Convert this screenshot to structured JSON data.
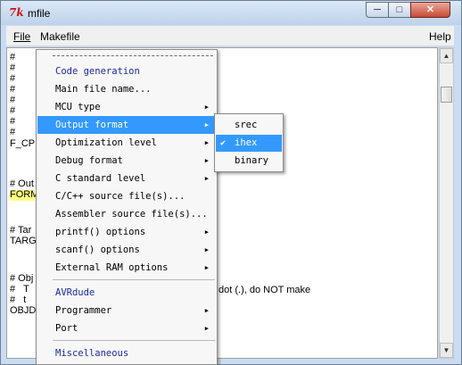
{
  "window": {
    "title": "mfile",
    "app_icon": "7k",
    "min": "─",
    "max": "□",
    "close": "✕"
  },
  "menubar": {
    "file": "File",
    "makefile": "Makefile",
    "help": "Help"
  },
  "editor": {
    "lines": [
      "#",
      "#",
      "#",
      "#",
      "#",
      "#",
      "#",
      "#",
      "F_CP",
      "",
      "# Out",
      "FORM",
      "",
      "",
      "# Tar",
      "TARG",
      "",
      "",
      "# Obj",
      "#   T",
      "#   t",
      "OBJD"
    ],
    "visible_tail": "dot (.), do NOT make"
  },
  "menu": {
    "items": [
      {
        "label": "Code generation",
        "header": true
      },
      {
        "label": "Main file name...",
        "mnemonic": "M"
      },
      {
        "label": "MCU type",
        "submenu": true
      },
      {
        "label": "Output format",
        "submenu": true,
        "selected": true
      },
      {
        "label": "Optimization level",
        "submenu": true
      },
      {
        "label": "Debug format",
        "submenu": true
      },
      {
        "label": "C standard level",
        "submenu": true
      },
      {
        "label": "C/C++ source file(s)..."
      },
      {
        "label": "Assembler source file(s)..."
      },
      {
        "label": "printf() options",
        "submenu": true
      },
      {
        "label": "scanf() options",
        "submenu": true
      },
      {
        "label": "External RAM options",
        "submenu": true
      },
      {
        "label": "AVRdude",
        "header": true
      },
      {
        "label": "Programmer",
        "submenu": true
      },
      {
        "label": "Port",
        "submenu": true
      },
      {
        "label": "Miscellaneous",
        "header": true
      }
    ]
  },
  "submenu": {
    "items": [
      {
        "label": "srec",
        "checked": false
      },
      {
        "label": "ihex",
        "checked": true
      },
      {
        "label": "binary",
        "checked": false
      }
    ],
    "check_glyph": "✔"
  },
  "colors": {
    "selection": "#3399ff",
    "header_text": "#1c2a9e",
    "highlight": "#ffff80"
  }
}
